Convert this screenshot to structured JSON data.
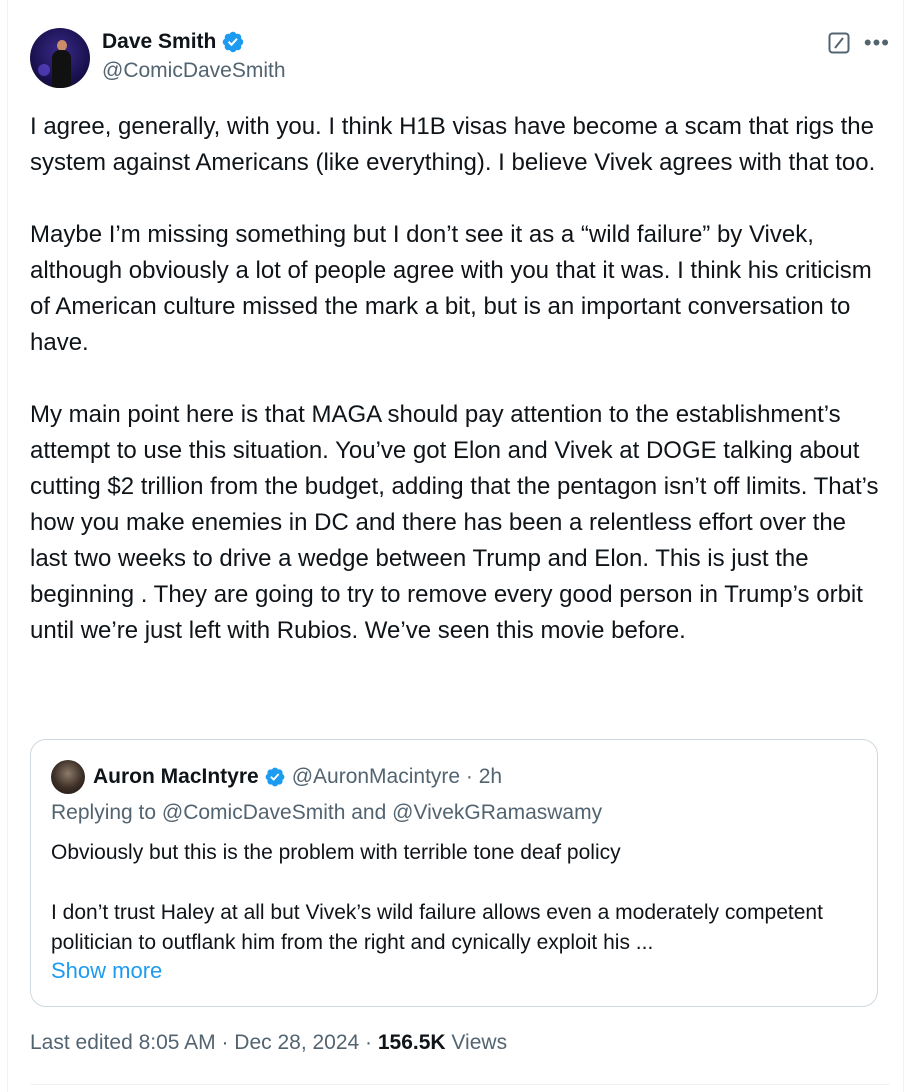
{
  "author": {
    "display_name": "Dave Smith",
    "handle": "@ComicDaveSmith",
    "verified": true
  },
  "icons": {
    "verified": "verified-badge-icon",
    "grok": "grok-icon",
    "more": "more-options-icon"
  },
  "tweet": {
    "paragraphs": [
      "I agree, generally, with you. I think H1B visas have become a scam that rigs the system against Americans (like everything). I believe Vivek agrees with that too.",
      "Maybe I’m missing something but I don’t see it as a “wild failure” by Vivek, although obviously a lot of people agree with you that it was. I think his criticism of American culture missed the mark a bit, but is an important conversation to have.",
      "My main point here is that MAGA should pay attention to the establishment’s attempt to use this situation. You’ve got Elon and Vivek at DOGE talking about cutting $2 trillion from the budget, adding that the pentagon isn’t off limits. That’s how you make enemies in DC and there has been a relentless effort over the last two weeks to drive a wedge between Trump and Elon. This is just the beginning . They are going to try to remove every good person in Trump’s orbit until we’re just left with Rubios. We’ve seen this movie before."
    ]
  },
  "quote": {
    "display_name": "Auron MacIntyre",
    "handle_time": "@AuronMacintyre · 2h",
    "verified": true,
    "replying_to": "Replying to @ComicDaveSmith and @VivekGRamaswamy",
    "paragraphs": [
      "Obviously but this is the problem with terrible tone deaf policy",
      "I don’t trust Haley at all but Vivek’s wild failure allows even a moderately competent politician to outflank him from the right and cynically exploit his ..."
    ],
    "show_more": "Show more"
  },
  "meta": {
    "edited": "Last edited 8:05 AM · Dec 28, 2024 · ",
    "views_count": "156.5K",
    "views_label": " Views"
  },
  "colors": {
    "text": "#0f1419",
    "secondary": "#536471",
    "link": "#1d9bf0",
    "border": "#cfd9de"
  }
}
